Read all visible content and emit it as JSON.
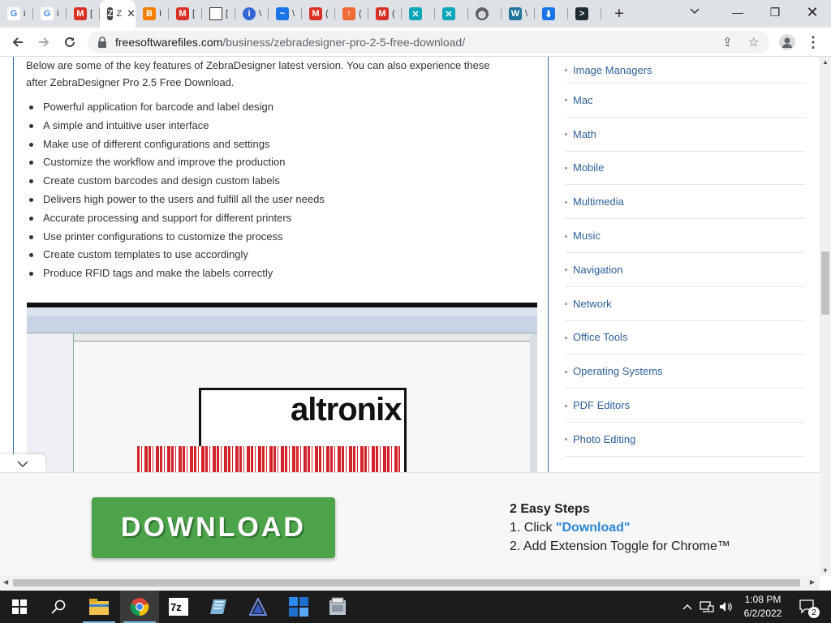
{
  "browser": {
    "tabs": [
      {
        "icon": "google-icon",
        "glyph": "G",
        "color": "#4285f4",
        "title": "i"
      },
      {
        "icon": "google-icon",
        "glyph": "G",
        "color": "#4285f4",
        "title": "i"
      },
      {
        "icon": "gmail-icon",
        "glyph": "M",
        "color": "#d93025",
        "title": "["
      },
      {
        "icon": "zebra-icon",
        "glyph": "Z",
        "color": "#444444",
        "title": "",
        "active": true
      },
      {
        "icon": "blogger-icon",
        "glyph": "B",
        "color": "#f57d00",
        "title": "I"
      },
      {
        "icon": "gmail-icon",
        "glyph": "M",
        "color": "#d93025",
        "title": "["
      },
      {
        "icon": "document-icon",
        "glyph": "",
        "color": "#ffffff",
        "title": "["
      },
      {
        "icon": "info-icon",
        "glyph": "i",
        "color": "#3367d6",
        "title": "\\"
      },
      {
        "icon": "swirl-icon",
        "glyph": "~",
        "color": "#1a73e8",
        "title": "\\"
      },
      {
        "icon": "gmail-icon",
        "glyph": "M",
        "color": "#d93025",
        "title": "("
      },
      {
        "icon": "upload-icon",
        "glyph": "↑",
        "color": "#f06a35",
        "title": "("
      },
      {
        "icon": "gmail-icon",
        "glyph": "M",
        "color": "#d93025",
        "title": "("
      },
      {
        "icon": "x-cross-icon",
        "glyph": "✕",
        "color": "#0aa5b8",
        "title": ""
      },
      {
        "icon": "x-cross-icon",
        "glyph": "✕",
        "color": "#0aa5b8",
        "title": ""
      },
      {
        "icon": "globe-icon",
        "glyph": "◍",
        "color": "#5f6368",
        "title": ""
      },
      {
        "icon": "wordpress-icon",
        "glyph": "W",
        "color": "#21759b",
        "title": "\\"
      },
      {
        "icon": "download-icon",
        "glyph": "⬇",
        "color": "#1a73e8",
        "title": ""
      },
      {
        "icon": "app-icon",
        "glyph": ">",
        "color": "#1f2b33",
        "title": ""
      }
    ],
    "active_tab_title": "Z",
    "url_host": "freesoftwarefiles.com",
    "url_path": "/business/zebradesigner-pro-2-5-free-download/"
  },
  "article": {
    "intro": "Below are some of the key features of ZebraDesigner latest version. You can also experience these after ZebraDesigner Pro 2.5 Free Download.",
    "features": [
      "Powerful application for barcode and label design",
      "A simple and intuitive user interface",
      "Make use of different configurations and settings",
      "Customize the workflow and improve the production",
      "Create custom barcodes and design custom labels",
      "Delivers high power to the users and fulfill all the user needs",
      "Accurate processing and support for different printers",
      "Use printer configurations to customize the process",
      "Create custom templates to use accordingly",
      "Produce RFID tags and make the labels correctly"
    ],
    "screenshot_brand": "altronix"
  },
  "sidebar": {
    "categories": [
      "Image Managers",
      "Mac",
      "Math",
      "Mobile",
      "Multimedia",
      "Music",
      "Navigation",
      "Network",
      "Office Tools",
      "Operating Systems",
      "PDF Editors",
      "Photo Editing"
    ]
  },
  "ad": {
    "button_label": "DOWNLOAD",
    "steps_title": "2 Easy Steps",
    "step1_prefix": "1. Click ",
    "step1_link": "\"Download\"",
    "step2": "2. Add Extension Toggle for Chrome™"
  },
  "taskbar": {
    "time": "1:08 PM",
    "date": "6/2/2022",
    "notification_count": "2"
  }
}
